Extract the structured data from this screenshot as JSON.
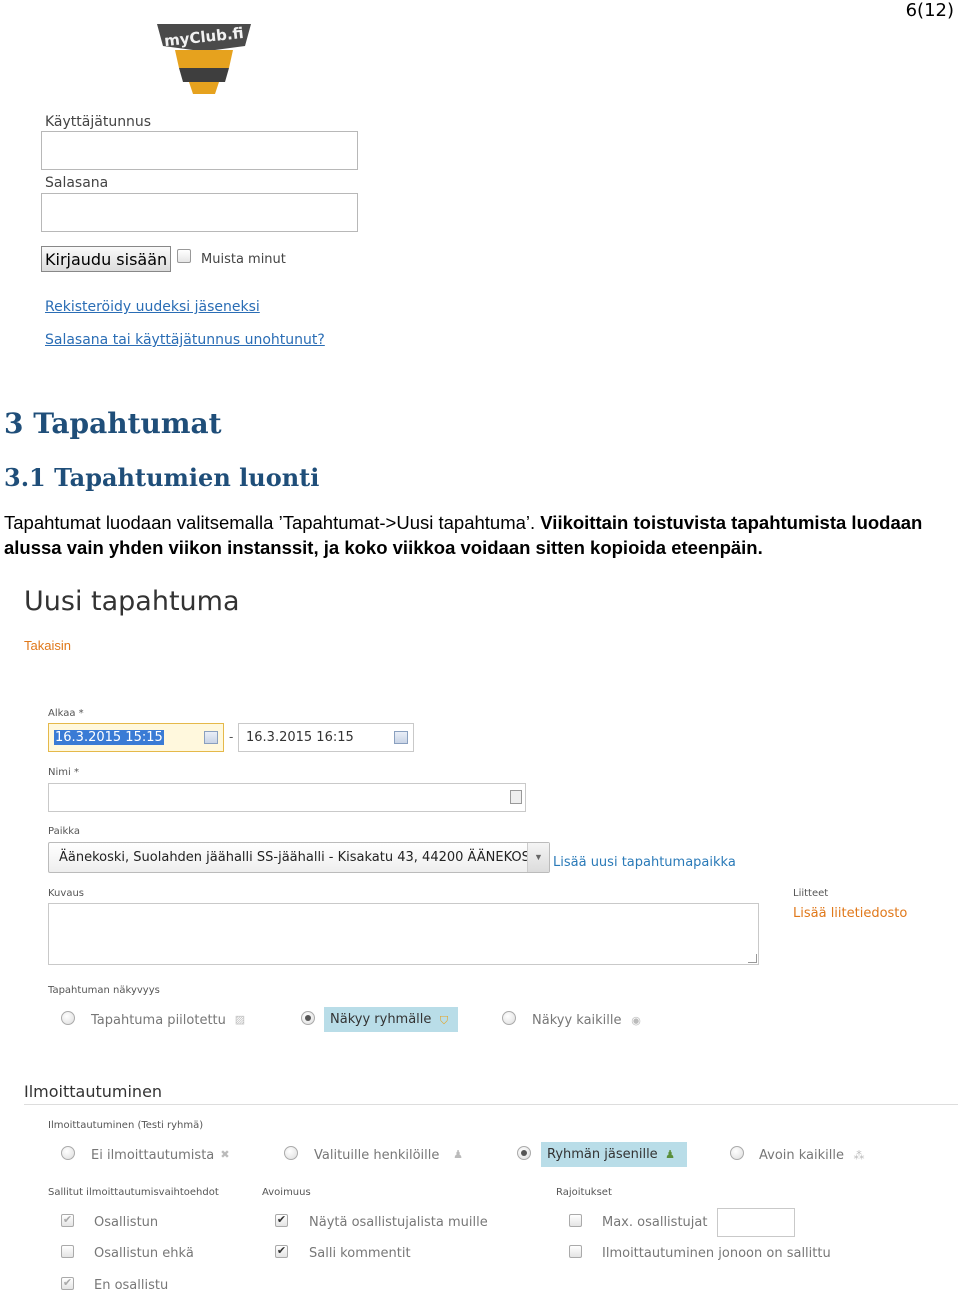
{
  "page_number": "6(12)",
  "login": {
    "logo_text": "myClub.fi",
    "username_label": "Käyttäjätunnus",
    "password_label": "Salasana",
    "login_button": "Kirjaudu sisään",
    "remember_label": "Muista minut",
    "register_link": "Rekisteröidy uudeksi jäseneksi",
    "forgot_link": "Salasana tai käyttäjätunnus unohtunut?"
  },
  "heading1": "3  Tapahtumat",
  "heading2": "3.1 Tapahtumien luonti",
  "paragraph": {
    "normal": "Tapahtumat luodaan valitsemalla ’Tapahtumat->Uusi tapahtuma’. ",
    "bold": "Viikoittain toistuvista tapahtumista luodaan alussa vain yhden viikon instanssit, ja koko viikkoa voidaan sitten kopioida eteenpäin."
  },
  "form": {
    "title": "Uusi tapahtuma",
    "back": "Takaisin",
    "alkaa_label": "Alkaa *",
    "start_value": "16.3.2015 15:15",
    "dash": "-",
    "end_value": "16.3.2015 16:15",
    "nimi_label": "Nimi *",
    "paikka_label": "Paikka",
    "paikka_value": "Äänekoski, Suolahden jäähalli SS-jäähalli - Kisakatu 43, 44200 ÄÄNEKOSKI",
    "add_place_link": "Lisää uusi tapahtumapaikka",
    "kuvaus_label": "Kuvaus",
    "liitteet_label": "Liitteet",
    "add_attachment_link": "Lisää liitetiedosto",
    "visibility_label": "Tapahtuman näkyvyys",
    "visibility_options": [
      "Tapahtuma piilotettu",
      "Näkyy ryhmälle",
      "Näkyy kaikille"
    ],
    "registration_section": "Ilmoittautuminen",
    "registration_label": "Ilmoittautuminen (Testi ryhmä)",
    "registration_options": [
      "Ei ilmoittautumista",
      "Valituille henkilöille",
      "Ryhmän jäsenille",
      "Avoin kaikille"
    ],
    "allowed_label": "Sallitut ilmoittautumisvaihtoehdot",
    "allowed_options": [
      "Osallistun",
      "Osallistun ehkä",
      "En osallistu"
    ],
    "openness_label": "Avoimuus",
    "openness_options": [
      "Näytä osallistujalista muille",
      "Salli kommentit"
    ],
    "limits_label": "Rajoitukset",
    "limits_options": [
      "Max. osallistujat",
      "Ilmoittautuminen jonoon on sallittu"
    ]
  }
}
